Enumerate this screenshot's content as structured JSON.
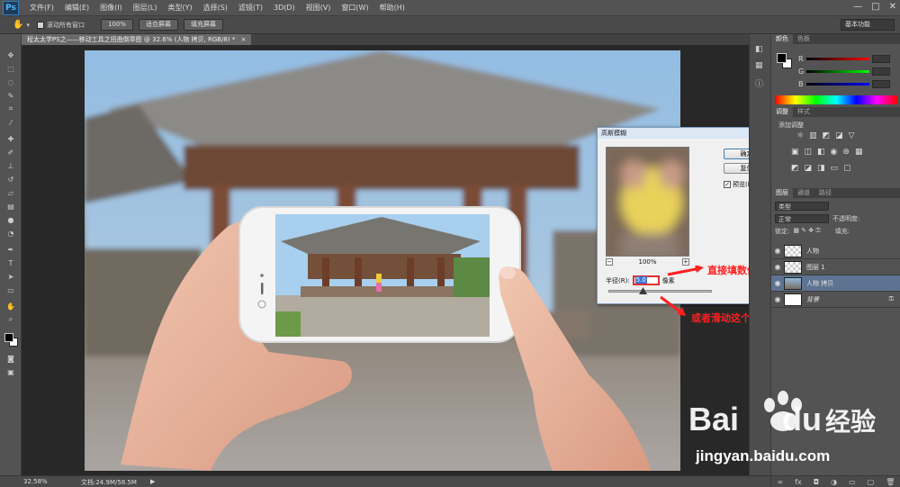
{
  "app": {
    "logo": "Ps"
  },
  "menu": [
    "文件(F)",
    "编辑(E)",
    "图像(I)",
    "图层(L)",
    "类型(Y)",
    "选择(S)",
    "滤镜(T)",
    "3D(D)",
    "视图(V)",
    "窗口(W)",
    "帮助(H)"
  ],
  "window_controls": {
    "minimize": "—",
    "maximize": "□",
    "close": "✕"
  },
  "options": {
    "tool_glyph": "✋",
    "scroll_all_label": "滚动所有窗口",
    "btn_100": "100%",
    "btn_fit": "适合屏幕",
    "btn_fill": "填充屏幕",
    "workspace": "基本功能"
  },
  "document": {
    "tab_title": "程太太学PS之——移动工具之扭曲倒章图 @ 32.6% (人物 拷贝, RGB/8) *",
    "tab_close": "×"
  },
  "status": {
    "zoom": "32.58%",
    "doc_size": "文档:24.9M/58.5M",
    "arrow": "▶"
  },
  "panels": {
    "color_tabs": [
      "颜色",
      "色板"
    ],
    "channels": [
      "R",
      "G",
      "B"
    ],
    "adjust_tabs": [
      "调整",
      "样式"
    ],
    "adjust_add": "添加调整",
    "layers_tabs": [
      "图层",
      "通道",
      "路径"
    ],
    "filter_kind": "类型",
    "blend_mode": "正常",
    "opacity_label": "不透明度:",
    "lock_label": "锁定:",
    "fill_label": "填充:",
    "layers": [
      {
        "name": "人物",
        "selected": false
      },
      {
        "name": "图层 1",
        "selected": false
      },
      {
        "name": "人物 拷贝",
        "selected": true
      },
      {
        "name": "背景",
        "selected": false
      }
    ]
  },
  "dialog": {
    "title": "高斯模糊",
    "ok": "确定",
    "reset": "复位",
    "preview_label": "预览(P)",
    "preview_checked": "✓",
    "zoom_pct": "100%",
    "zoom_out": "−",
    "zoom_in": "+",
    "radius_label": "半径(R):",
    "radius_value": "5.0",
    "radius_unit": "像素"
  },
  "annotations": {
    "fill_value": "直接填数值",
    "slide": "或者滑动这个"
  },
  "watermark": {
    "brand": "Bai",
    "brand2": "du",
    "cn": "经验",
    "url": "jingyan.baidu.com"
  },
  "colors": {
    "annot_red": "#ff2020",
    "selected_layer": "#5e7391",
    "ps_blue": "#56b4f3"
  }
}
